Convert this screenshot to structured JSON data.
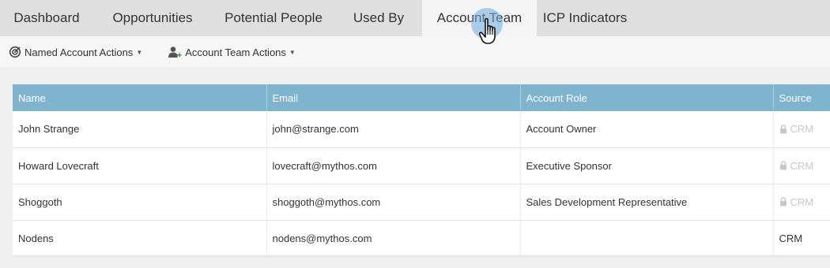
{
  "tabs": [
    {
      "label": "Dashboard"
    },
    {
      "label": "Opportunities"
    },
    {
      "label": "Potential People"
    },
    {
      "label": "Used By"
    },
    {
      "label": "Account Team",
      "active": true
    },
    {
      "label": "ICP Indicators"
    }
  ],
  "toolbar": {
    "named_account_actions": "Named Account Actions",
    "account_team_actions": "Account Team Actions"
  },
  "table": {
    "headers": [
      "Name",
      "Email",
      "Account Role",
      "Source"
    ],
    "rows": [
      {
        "name": "John Strange",
        "email": "john@strange.com",
        "role": "Account Owner",
        "source": "CRM",
        "locked": true
      },
      {
        "name": "Howard Lovecraft",
        "email": "lovecraft@mythos.com",
        "role": "Executive Sponsor",
        "source": "CRM",
        "locked": true
      },
      {
        "name": "Shoggoth",
        "email": "shoggoth@mythos.com",
        "role": "Sales Development Representative",
        "source": "CRM",
        "locked": true
      },
      {
        "name": "Nodens",
        "email": "nodens@mythos.com",
        "role": "",
        "source": "CRM",
        "locked": false
      }
    ]
  },
  "colors": {
    "header_bg": "#7fb4cf",
    "tab_bar": "#dfdfdf",
    "active_tab": "#f5f5f5",
    "locked_text": "#c7c7c7"
  }
}
